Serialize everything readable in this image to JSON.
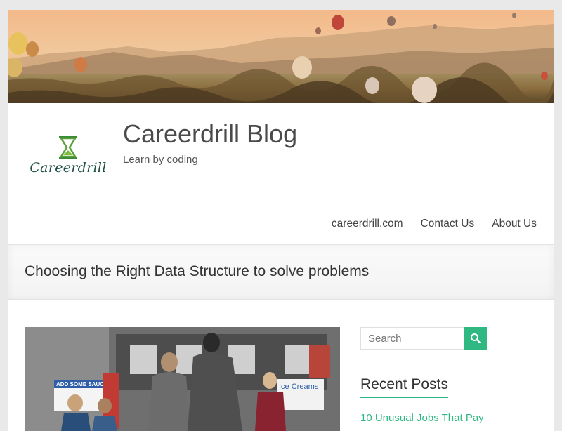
{
  "header": {
    "logo_text": "Careerdrill",
    "site_title": "Careerdrill Blog",
    "tagline": "Learn by coding"
  },
  "nav": {
    "items": [
      {
        "label": "careerdrill.com"
      },
      {
        "label": "Contact Us"
      },
      {
        "label": "About Us"
      }
    ]
  },
  "page": {
    "title": "Choosing the Right Data Structure to solve problems"
  },
  "featured_image": {
    "sign_left": "ADD SOME SAUCE!",
    "sign_right": "Ice Creams"
  },
  "sidebar": {
    "search": {
      "placeholder": "Search"
    },
    "recent_posts": {
      "title": "Recent Posts",
      "items": [
        {
          "label": "10 Unusual Jobs That Pay"
        }
      ]
    }
  },
  "colors": {
    "accent": "#30b883",
    "text": "#333333",
    "background": "#e9e9e9"
  }
}
